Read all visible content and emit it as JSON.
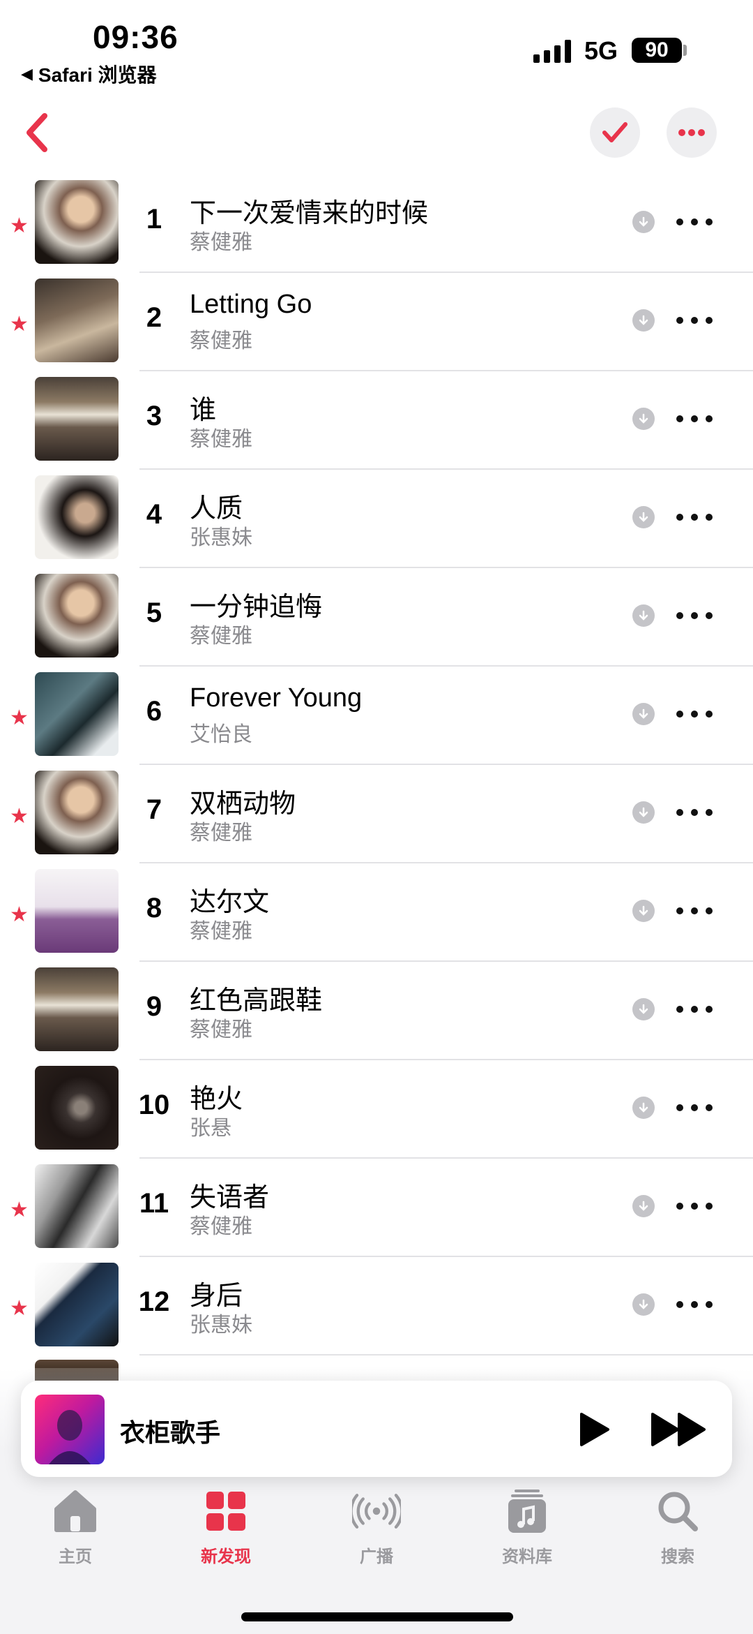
{
  "status_bar": {
    "time": "09:36",
    "back_app": "Safari 浏览器",
    "network": "5G",
    "battery": "90"
  },
  "songs": [
    {
      "num": "1",
      "title": "下一次爱情来的时候",
      "artist": "蔡健雅",
      "starred": true
    },
    {
      "num": "2",
      "title": "Letting Go",
      "artist": "蔡健雅",
      "starred": true
    },
    {
      "num": "3",
      "title": "谁",
      "artist": "蔡健雅",
      "starred": false
    },
    {
      "num": "4",
      "title": "人质",
      "artist": "张惠妹",
      "starred": false
    },
    {
      "num": "5",
      "title": "一分钟追悔",
      "artist": "蔡健雅",
      "starred": false
    },
    {
      "num": "6",
      "title": "Forever Young",
      "artist": "艾怡良",
      "starred": true
    },
    {
      "num": "7",
      "title": "双栖动物",
      "artist": "蔡健雅",
      "starred": true
    },
    {
      "num": "8",
      "title": "达尔文",
      "artist": "蔡健雅",
      "starred": true
    },
    {
      "num": "9",
      "title": "红色高跟鞋",
      "artist": "蔡健雅",
      "starred": false
    },
    {
      "num": "10",
      "title": "艳火",
      "artist": "张悬",
      "starred": false
    },
    {
      "num": "11",
      "title": "失语者",
      "artist": "蔡健雅",
      "starred": true
    },
    {
      "num": "12",
      "title": "身后",
      "artist": "张惠妹",
      "starred": true
    }
  ],
  "now_playing": {
    "title": "衣柜歌手"
  },
  "tabs": [
    {
      "label": "主页",
      "icon": "home-icon"
    },
    {
      "label": "新发现",
      "icon": "grid-icon"
    },
    {
      "label": "广播",
      "icon": "radio-icon"
    },
    {
      "label": "资料库",
      "icon": "library-icon"
    },
    {
      "label": "搜索",
      "icon": "search-icon"
    }
  ],
  "colors": {
    "accent": "#e8344b",
    "secondary_text": "#8a8a8e"
  }
}
